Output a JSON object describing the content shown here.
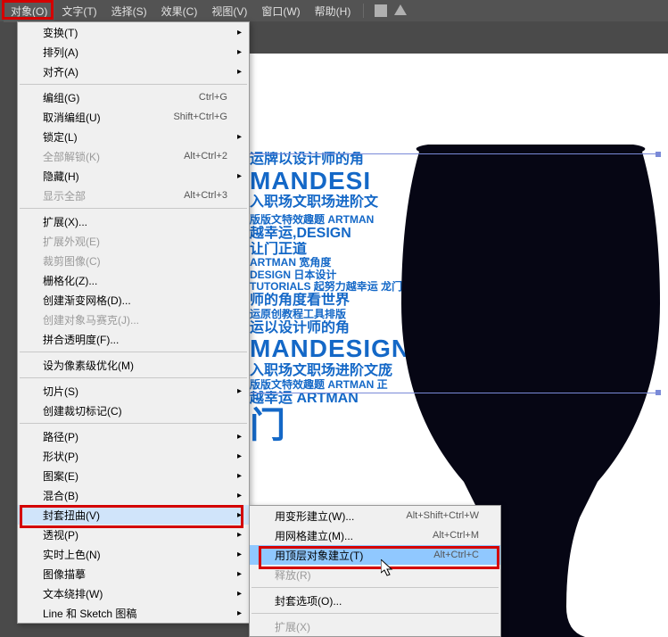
{
  "menubar": {
    "object": "对象(O)",
    "type": "文字(T)",
    "select": "选择(S)",
    "effect": "效果(C)",
    "view": "视图(V)",
    "window": "窗口(W)",
    "help": "帮助(H)"
  },
  "menu": {
    "transform": "变换(T)",
    "arrange": "排列(A)",
    "align": "对齐(A)",
    "group": "编组(G)",
    "group_sc": "Ctrl+G",
    "ungroup": "取消编组(U)",
    "ungroup_sc": "Shift+Ctrl+G",
    "lock": "锁定(L)",
    "unlock_all": "全部解锁(K)",
    "unlock_all_sc": "Alt+Ctrl+2",
    "hide": "隐藏(H)",
    "show_all": "显示全部",
    "show_all_sc": "Alt+Ctrl+3",
    "expand": "扩展(X)...",
    "expand_app": "扩展外观(E)",
    "crop_img": "裁剪图像(C)",
    "rasterize": "栅格化(Z)...",
    "grad_mesh": "创建渐变网格(D)...",
    "obj_mosaic": "创建对象马赛克(J)...",
    "flat_trans": "拼合透明度(F)...",
    "pixel_perfect": "设为像素级优化(M)",
    "slice": "切片(S)",
    "trim_marks": "创建裁切标记(C)",
    "path": "路径(P)",
    "shape": "形状(P)",
    "pattern": "图案(E)",
    "blend": "混合(B)",
    "envelope": "封套扭曲(V)",
    "perspective": "透视(P)",
    "live_paint": "实时上色(N)",
    "image_trace": "图像描摹",
    "text_wrap": "文本绕排(W)",
    "line_sketch": "Line 和 Sketch 图稿"
  },
  "submenu": {
    "warp": "用变形建立(W)...",
    "warp_sc": "Alt+Shift+Ctrl+W",
    "mesh": "用网格建立(M)...",
    "mesh_sc": "Alt+Ctrl+M",
    "top_obj": "用顶层对象建立(T)",
    "top_obj_sc": "Alt+Ctrl+C",
    "release": "释放(R)",
    "env_opt": "封套选项(O)...",
    "expand": "扩展(X)"
  },
  "canvas": {
    "l1": "运牌以设计师的角",
    "l2": "MANDESI",
    "l3": "入职场文职场进阶文",
    "l4": "越幸运,DESIGN",
    "l5": "让门正道",
    "l6": "龙门正道",
    "l7": "师的角度看世界",
    "l8": "运原创教程工具排版",
    "l9": "运以设计师的角",
    "l10": "MANDESIGN",
    "l11": "入职场文职场进阶文庞",
    "l12": "越幸运 ARTMAN",
    "l13": "门"
  }
}
